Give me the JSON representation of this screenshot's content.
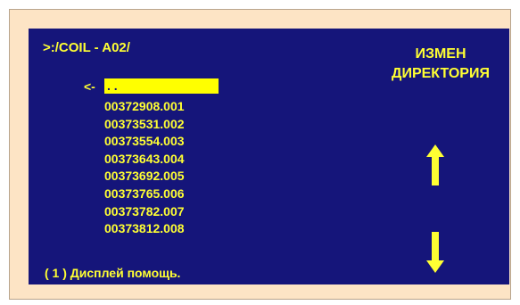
{
  "screen": {
    "path": ">:/COIL - A02/",
    "back_indicator": "<-",
    "selected_item": ". .",
    "files": [
      "00372908.001",
      "00373531.002",
      "00373554.003",
      "00373643.004",
      "00373692.005",
      "00373765.006",
      "00373782.007",
      "00373812.008"
    ],
    "right_title_line1": "ИЗМЕН",
    "right_title_line2": "ДИРЕКТОРИЯ",
    "help_text": "( 1 ) Дисплей помощь."
  },
  "colors": {
    "background": "#15157a",
    "text": "#ffff33",
    "highlight": "#ffff00",
    "frame": "#fde4c5"
  },
  "icons": {
    "up": "arrow-up-icon",
    "down": "arrow-down-icon"
  }
}
